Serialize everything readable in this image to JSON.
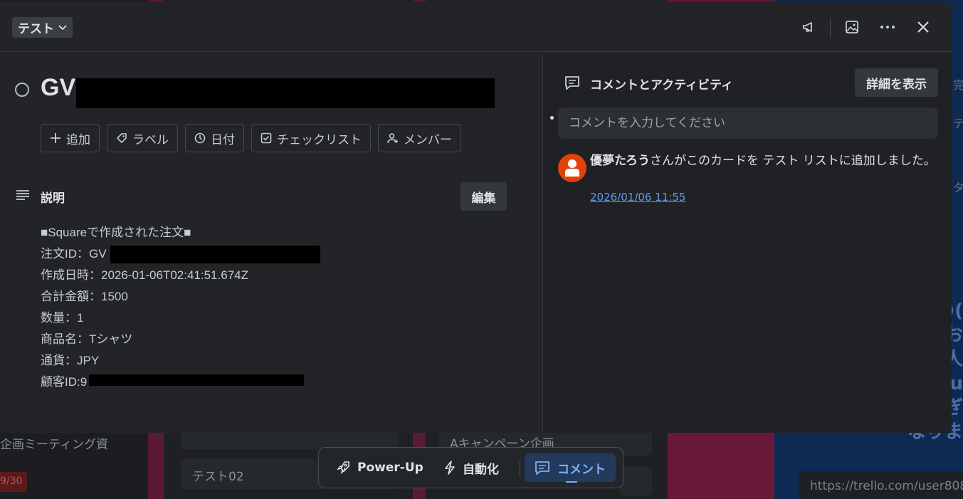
{
  "background": {
    "card_1": "企画ミーティング資",
    "badge": "9/30",
    "card_2": "テスト02",
    "card_3": "Aキャンペーン企画",
    "side_text_1": "完",
    "side_text_2": "テ",
    "side_text_3": "タ",
    "right_big_text": "の(\nお\n人\nu\nぎ\nなりま",
    "url_hint": "https://trello.com/user808"
  },
  "header": {
    "list_name": "テスト",
    "icons": [
      "megaphone-icon",
      "image-icon",
      "more-icon",
      "close-icon"
    ]
  },
  "card": {
    "title": "GV"
  },
  "actions": [
    {
      "icon": "plus-icon",
      "label": "追加"
    },
    {
      "icon": "label-icon",
      "label": "ラベル"
    },
    {
      "icon": "clock-icon",
      "label": "日付"
    },
    {
      "icon": "checkbox-icon",
      "label": "チェックリスト"
    },
    {
      "icon": "add-member-icon",
      "label": "メンバー"
    }
  ],
  "description": {
    "title": "説明",
    "edit_label": "編集",
    "lines": [
      "■Squareで作成された注文■",
      "注文ID：GV",
      "作成日時：2026-01-06T02:41:51.674Z",
      "合計金額：1500",
      "数量：1",
      "商品名：Tシャツ",
      "通貨：JPY",
      "顧客ID:9"
    ]
  },
  "activity": {
    "title": "コメントとアクティビティ",
    "detail_label": "詳細を表示",
    "comment_placeholder": "コメントを入力してください",
    "entry": {
      "user": "優夢たろう",
      "text": "さんがこのカードを テスト リストに追加しました。",
      "time": "2026/01/06 11:55"
    }
  },
  "toolbar": {
    "powerup": "Power-Up",
    "automation": "自動化",
    "comment": "コメント"
  },
  "colors": {
    "avatar": "#e2410a",
    "link": "#5f9cf0",
    "active_tab": "#233a5c"
  }
}
